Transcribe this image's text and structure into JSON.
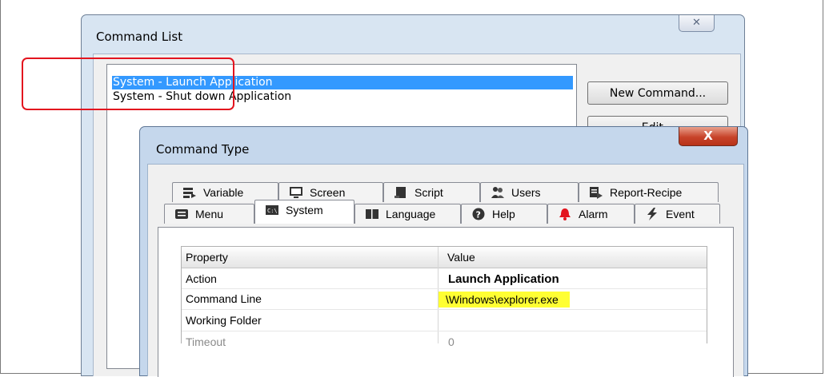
{
  "command_list": {
    "title": "Command List",
    "close_glyph": "✕",
    "items": [
      {
        "label": "System - Launch Application",
        "selected": true
      },
      {
        "label": "System - Shut down Application",
        "selected": false
      }
    ],
    "buttons": {
      "new_command": "New Command...",
      "edit": "Edit..."
    }
  },
  "command_type": {
    "title": "Command Type",
    "close_glyph": "X",
    "tabs_row1": [
      "Variable",
      "Screen",
      "Script",
      "Users",
      "Report-Recipe"
    ],
    "tabs_row2": [
      "Menu",
      "System",
      "Language",
      "Help",
      "Alarm",
      "Event"
    ],
    "active_tab": "System",
    "table": {
      "headers": {
        "property": "Property",
        "value": "Value"
      },
      "rows": [
        {
          "property": "Action",
          "value": "Launch Application"
        },
        {
          "property": "Command Line",
          "value": "\\Windows\\explorer.exe"
        },
        {
          "property": "Working Folder",
          "value": ""
        },
        {
          "property": "Timeout",
          "value": "0"
        }
      ]
    }
  },
  "colors": {
    "selection": "#3399ff",
    "highlight_ring": "#e3141e",
    "value_highlight": "#ffff33",
    "close_red": "#c7432a"
  }
}
